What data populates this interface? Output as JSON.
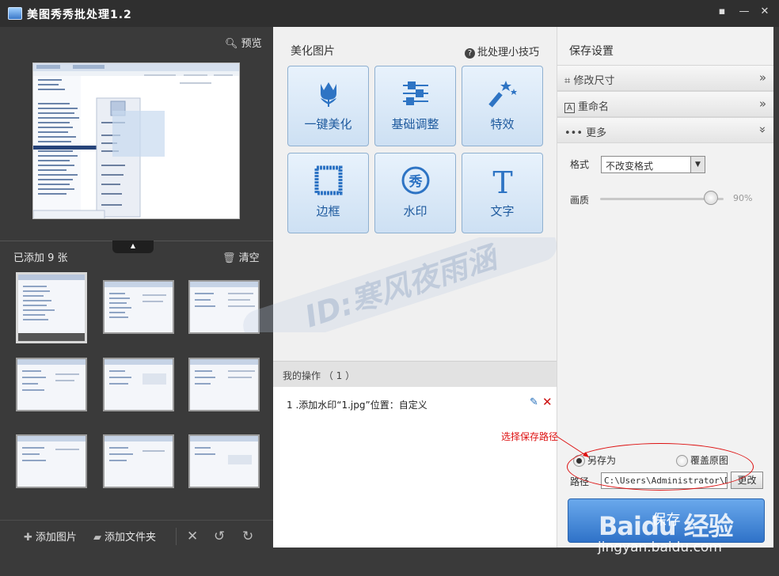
{
  "window": {
    "title": "美图秀秀批处理1.2",
    "controls": [
      "feedback-icon",
      "minimize-icon",
      "close-icon"
    ]
  },
  "left": {
    "preview_label": "预览",
    "added_count": "已添加 9 张",
    "clear_label": "清空",
    "thumbnails": 9,
    "toolbar": {
      "add_image": "添加图片",
      "add_folder": "添加文件夹",
      "icons": [
        "remove-icon",
        "rotate-left-icon",
        "rotate-right-icon"
      ]
    }
  },
  "center": {
    "beautify_title": "美化图片",
    "tips_link": "批处理小技巧",
    "tools": [
      {
        "label": "一键美化",
        "icon": "tulip-icon"
      },
      {
        "label": "基础调整",
        "icon": "sliders-icon"
      },
      {
        "label": "特效",
        "icon": "magic-wand-icon"
      },
      {
        "label": "边框",
        "icon": "frame-icon"
      },
      {
        "label": "水印",
        "icon": "watermark-stamp-icon"
      },
      {
        "label": "文字",
        "icon": "text-t-icon"
      }
    ],
    "ops_title": "我的操作 （ 1 ）",
    "ops": [
      {
        "text": "1 .添加水印“1.jpg”位置：自定义"
      }
    ]
  },
  "right": {
    "title": "保存设置",
    "sections": [
      {
        "label": "修改尺寸",
        "arrow": "»"
      },
      {
        "label": "重命名",
        "arrow": "»"
      },
      {
        "label": "更多",
        "arrow": "»"
      }
    ],
    "format_label": "格式",
    "format_value": "不改变格式",
    "quality_label": "画质",
    "quality_value": "90%",
    "quality_fraction": 0.9,
    "radio_save_as": "另存为",
    "radio_overwrite": "覆盖原图",
    "path_label": "路径",
    "path_value": "C:\\Users\\Administrator\\Do",
    "change_button": "更改",
    "save_button": "保存"
  },
  "annotation": {
    "text": "选择保存路径",
    "color": "#dd1111"
  },
  "watermark": {
    "text": "ID:寒风夜雨涵",
    "baidu_logo": "Baidu 经验",
    "baidu_url": "jingyan.baidu.com"
  },
  "colors": {
    "titlebar": "#2f2f2f",
    "accent": "#2f72c8",
    "tool_text": "#1e5a9e"
  }
}
